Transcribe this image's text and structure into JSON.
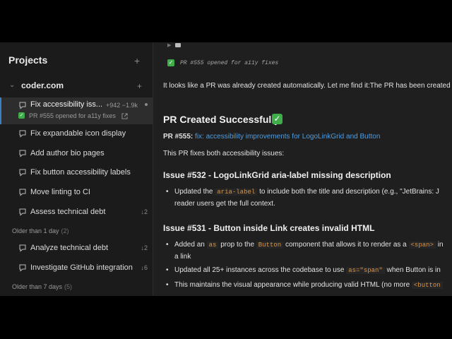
{
  "sidebar": {
    "title": "Projects",
    "add_icon": "plus-icon",
    "org": {
      "name": "coder.com",
      "toggle_icon": "chevron-down-icon",
      "add_icon": "plus-icon"
    },
    "active_item": {
      "label": "Fix accessibility iss...",
      "diff": "+942 −1.9k",
      "subtitle": "PR #555 opened for a11y fixes",
      "status_icon": "check-icon",
      "link_icon": "external-link-icon"
    },
    "items": [
      {
        "label": "Fix expandable icon display",
        "icon": "chat-icon",
        "count": ""
      },
      {
        "label": "Add author bio pages",
        "icon": "chat-icon",
        "count": ""
      },
      {
        "label": "Fix button accessibility labels",
        "icon": "chat-icon",
        "count": ""
      },
      {
        "label": "Move linting to CI",
        "icon": "chat-icon",
        "count": ""
      },
      {
        "label": "Assess technical debt",
        "icon": "chat-icon",
        "count": "↓2"
      }
    ],
    "groups": [
      {
        "label": "Older than 1 day",
        "count": "(2)",
        "items": [
          {
            "label": "Analyze technical debt",
            "icon": "chat-icon",
            "count": "↓2"
          },
          {
            "label": "Investigate GitHub integration",
            "icon": "chat-icon",
            "count": "↓6"
          }
        ]
      },
      {
        "label": "Older than 7 days",
        "count": "(5)"
      }
    ]
  },
  "main": {
    "tool_result": "PR #555 opened for a11y fixes",
    "intro": "It looks like a PR was already created automatically. Let me find it:The PR has been created",
    "heading": "PR Created Successfully",
    "pr_prefix": "PR #555",
    "pr_colon": ":",
    "pr_link": "fix: accessibility improvements for LogoLinkGrid and Button",
    "summary": "This PR fixes both accessibility issues:",
    "issue1": {
      "title": "Issue #532 - LogoLinkGrid aria-label missing description",
      "b1_a": "Updated the",
      "b1_code": "aria-label",
      "b1_b": "to include both the title and description (e.g., \"JetBrains: J",
      "b1_c": "reader users get the full context."
    },
    "issue2": {
      "title": "Issue #531 - Button inside Link creates invalid HTML",
      "b1_a": "Added an",
      "b1_code1": "as",
      "b1_b": "prop to the",
      "b1_code2": "Button",
      "b1_c": "component that allows it to render as a",
      "b1_code3": "<span>",
      "b1_d": "in",
      "b1_e": "a link",
      "b2_a": "Updated all 25+ instances across the codebase to use",
      "b2_code": "as=\"span\"",
      "b2_b": "when Button is in",
      "b3_a": "This maintains the visual appearance while producing valid HTML (no more",
      "b3_code": "<button"
    }
  }
}
